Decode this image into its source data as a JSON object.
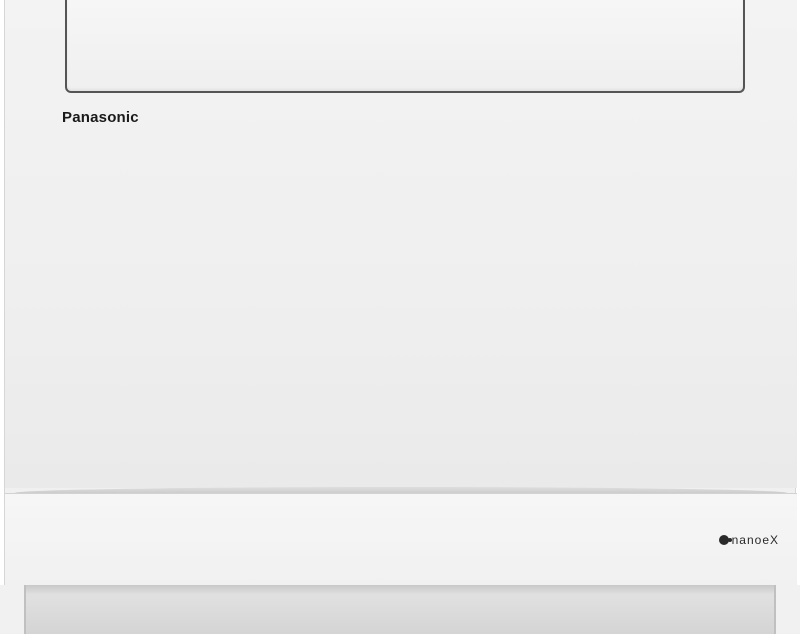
{
  "product": {
    "brand_logo_text": "Panasonic",
    "badge_text": "nanoeX",
    "colors": {
      "body": "#f1f1f1",
      "flap_outline": "#555555",
      "logo": "#1a1a1a"
    }
  }
}
